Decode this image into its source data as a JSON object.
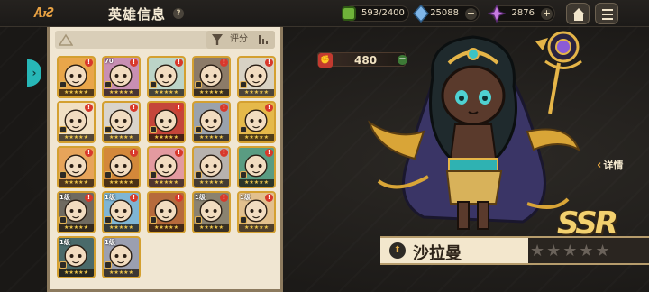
{
  "header": {
    "back_label": "ΑᴊƧ",
    "title": "英雄信息",
    "help_glyph": "?"
  },
  "resources": [
    {
      "name": "stamina",
      "value": "593/2400",
      "color": "#6fb23a",
      "icon": "stamina-icon"
    },
    {
      "name": "crystal",
      "value": "25088",
      "color": "#7fb6e8",
      "icon": "crystal-icon"
    },
    {
      "name": "gem",
      "value": "2876",
      "color": "#c77be0",
      "icon": "gem-icon"
    }
  ],
  "side_tab": {
    "glyph": "›"
  },
  "filter": {
    "sort_label": "评分"
  },
  "heroes": [
    {
      "level": "",
      "badge": "!",
      "stars": "★★★★★",
      "bg": "#e9a64a"
    },
    {
      "level": "70",
      "badge": "!",
      "stars": "★★★★★",
      "bg": "#c88fb3"
    },
    {
      "level": "",
      "badge": "!",
      "stars": "★★★★★",
      "bg": "#bcd4c8"
    },
    {
      "level": "",
      "badge": "!",
      "stars": "★★★★★",
      "bg": "#8c7b68"
    },
    {
      "level": "",
      "badge": "!",
      "stars": "★★★★★",
      "bg": "#d8d2c4"
    },
    {
      "level": "",
      "badge": "!",
      "stars": "★★★★★",
      "bg": "#f1e0c4"
    },
    {
      "level": "",
      "badge": "!",
      "stars": "★★★★★",
      "bg": "#d9d4cc"
    },
    {
      "level": "",
      "badge": "!",
      "stars": "★★★★★",
      "bg": "#c5453a"
    },
    {
      "level": "",
      "badge": "!",
      "stars": "★★★★★",
      "bg": "#9aa2ac"
    },
    {
      "level": "",
      "badge": "!",
      "stars": "★★★★★",
      "bg": "#e5b94a"
    },
    {
      "level": "",
      "badge": "!",
      "stars": "★★★★★",
      "bg": "#e7a45a"
    },
    {
      "level": "",
      "badge": "!",
      "stars": "★★★★★",
      "bg": "#d3883a"
    },
    {
      "level": "",
      "badge": "!",
      "stars": "★★★★★",
      "bg": "#e39aa0"
    },
    {
      "level": "",
      "badge": "!",
      "stars": "★★★★★",
      "bg": "#b7b2ae"
    },
    {
      "level": "",
      "badge": "!",
      "stars": "★★★★★",
      "bg": "#5a9c82"
    },
    {
      "level": "1级",
      "badge": "!",
      "stars": "★★★★★",
      "bg": "#6f6a60"
    },
    {
      "level": "1级",
      "badge": "!",
      "stars": "★★★★★",
      "bg": "#7fb5d4"
    },
    {
      "level": "",
      "badge": "!",
      "stars": "★★★★★",
      "bg": "#b66a3c"
    },
    {
      "level": "1级",
      "badge": "!",
      "stars": "★★★★★",
      "bg": "#8a8270"
    },
    {
      "level": "1级",
      "badge": "!",
      "stars": "★★★★★",
      "bg": "#e2c08e"
    },
    {
      "level": "1级",
      "badge": "",
      "stars": "★★★★★",
      "bg": "#4a6a6a"
    },
    {
      "level": "1级",
      "badge": "",
      "stars": "★★★★★",
      "bg": "#9b9fb0"
    }
  ],
  "hero": {
    "power": "480",
    "rarity": "SSR",
    "name": "沙拉曼",
    "stars": "★★★★★",
    "detail_label": "详情"
  }
}
